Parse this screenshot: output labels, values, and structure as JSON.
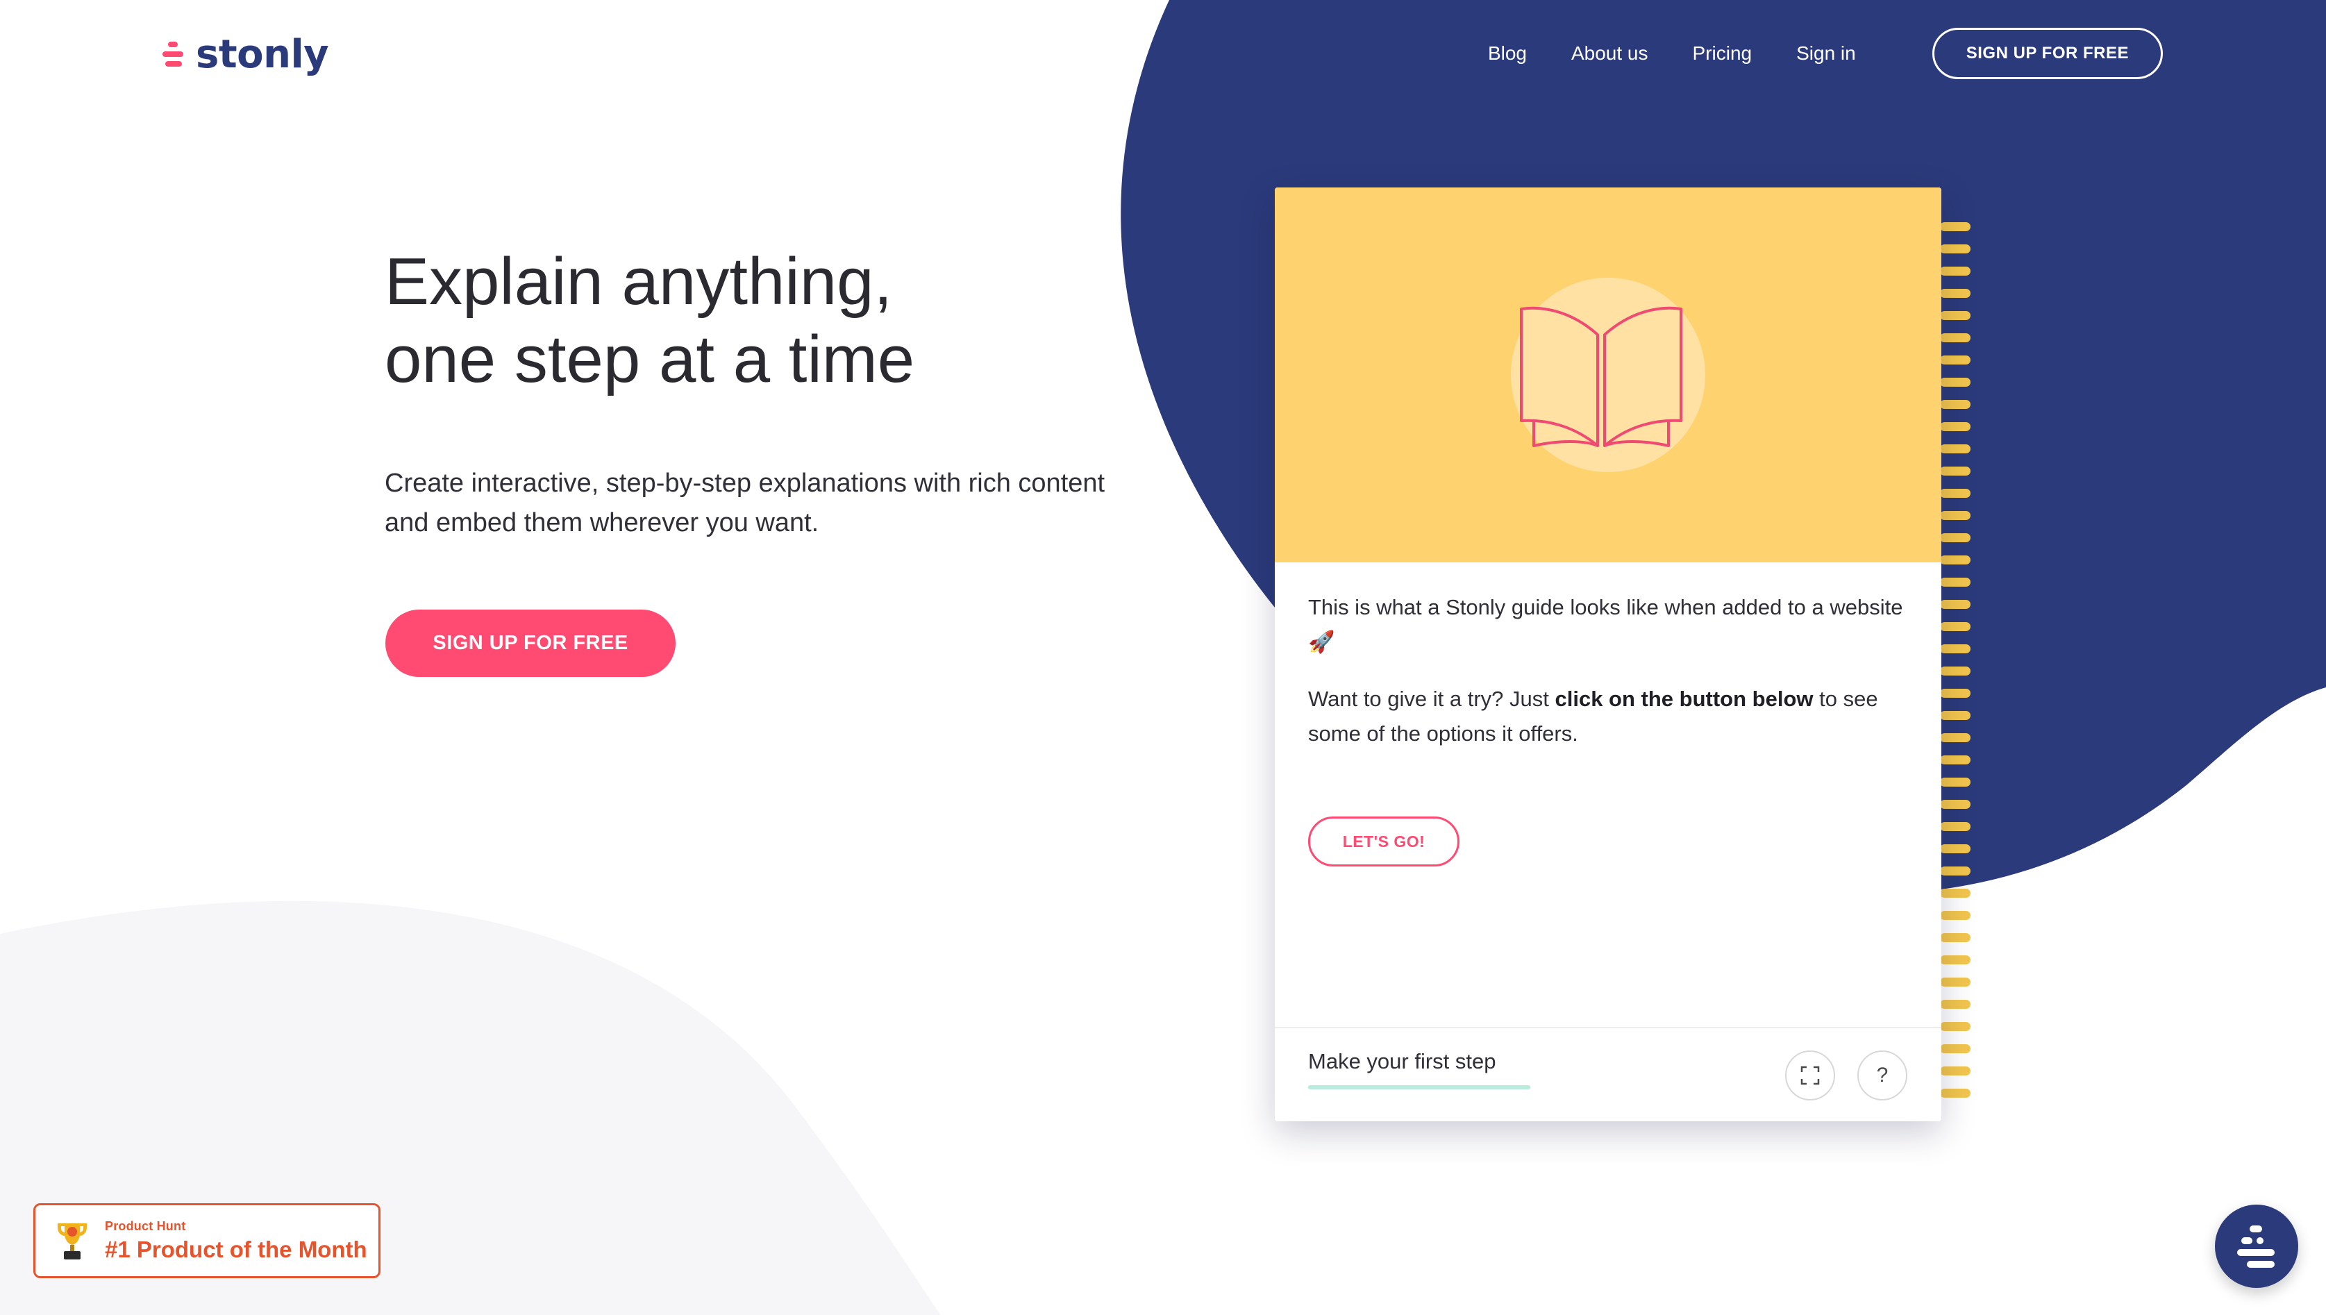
{
  "brand": {
    "name": "stonly",
    "accent_color": "#ff4a72",
    "navy_color": "#2b3a7a",
    "yellow_color": "#ffd270"
  },
  "nav": {
    "items": [
      {
        "label": "Blog"
      },
      {
        "label": "About us"
      },
      {
        "label": "Pricing"
      },
      {
        "label": "Sign in"
      }
    ],
    "cta_label": "SIGN UP FOR FREE"
  },
  "hero": {
    "title_line1": "Explain anything,",
    "title_line2": "one step at a time",
    "subtitle": "Create interactive, step-by-step explanations with rich content and embed them wherever you want.",
    "cta_label": "SIGN UP FOR FREE"
  },
  "guide": {
    "icon": "open-book-icon",
    "paragraph1_text": "This is what a Stonly guide looks like when added to a website",
    "paragraph1_emoji": "🚀",
    "paragraph2_before": "Want to give it a try? Just ",
    "paragraph2_bold": "click on the button below",
    "paragraph2_after": " to see some of the options it offers.",
    "button_label": "LET'S GO!",
    "footer_step_label": "Make your first step",
    "progress": 1.0,
    "fullscreen_icon": "fullscreen-icon",
    "help_label": "?"
  },
  "badge": {
    "small_label": "Product Hunt",
    "big_label": "#1 Product of the Month",
    "icon": "trophy-icon"
  },
  "chat": {
    "icon": "stonly-launcher-icon"
  }
}
